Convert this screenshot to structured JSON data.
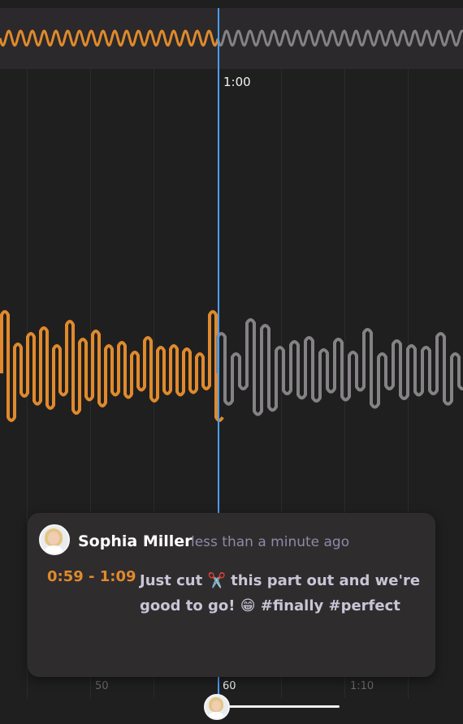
{
  "playhead": {
    "time_label": "1:00"
  },
  "ruler": {
    "ticks": [
      "50",
      "60",
      "1:10"
    ]
  },
  "comment": {
    "author": "Sophia Miller",
    "posted": "less than a minute ago",
    "range": "0:59 - 1:09",
    "text": "Just cut ✂️ this part out and we're good to go! 😁 #finally #perfect"
  },
  "colors": {
    "played": "#e08a2c",
    "unplayed": "#848284",
    "playhead": "#4a9eff",
    "background": "#201f20"
  },
  "icons": {
    "avatar": "user-avatar",
    "scrubber_avatar": "user-avatar"
  }
}
